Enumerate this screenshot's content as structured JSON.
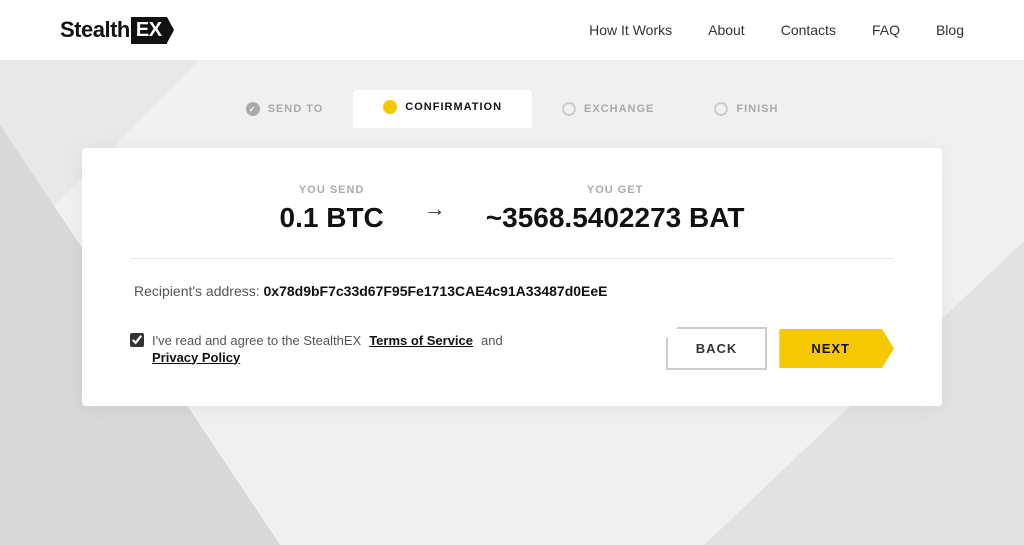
{
  "header": {
    "logo_text": "Stealth",
    "logo_highlight": "EX",
    "nav": [
      {
        "label": "How It Works",
        "href": "#"
      },
      {
        "label": "About",
        "href": "#"
      },
      {
        "label": "Contacts",
        "href": "#"
      },
      {
        "label": "FAQ",
        "href": "#"
      },
      {
        "label": "Blog",
        "href": "#"
      }
    ]
  },
  "steps": [
    {
      "id": "send-to",
      "label": "SEND TO",
      "state": "done"
    },
    {
      "id": "confirmation",
      "label": "CONFIRMATION",
      "state": "active"
    },
    {
      "id": "exchange",
      "label": "EXCHANGE",
      "state": "inactive"
    },
    {
      "id": "finish",
      "label": "FINISH",
      "state": "inactive"
    }
  ],
  "card": {
    "you_send_label": "YOU SEND",
    "you_send_amount": "0.1 BTC",
    "you_get_label": "YOU GET",
    "you_get_amount": "~3568.5402273 BAT",
    "recipient_label": "Recipient's address:",
    "recipient_address": "0x78d9bF7c33d67F95Fe1713CAE4c91A33487d0EeE",
    "checkbox_text_pre": "I've read and agree to the StealthEX",
    "terms_label": "Terms of Service",
    "checkbox_text_mid": "and",
    "privacy_label": "Privacy Policy",
    "back_label": "BACK",
    "next_label": "NEXT"
  }
}
